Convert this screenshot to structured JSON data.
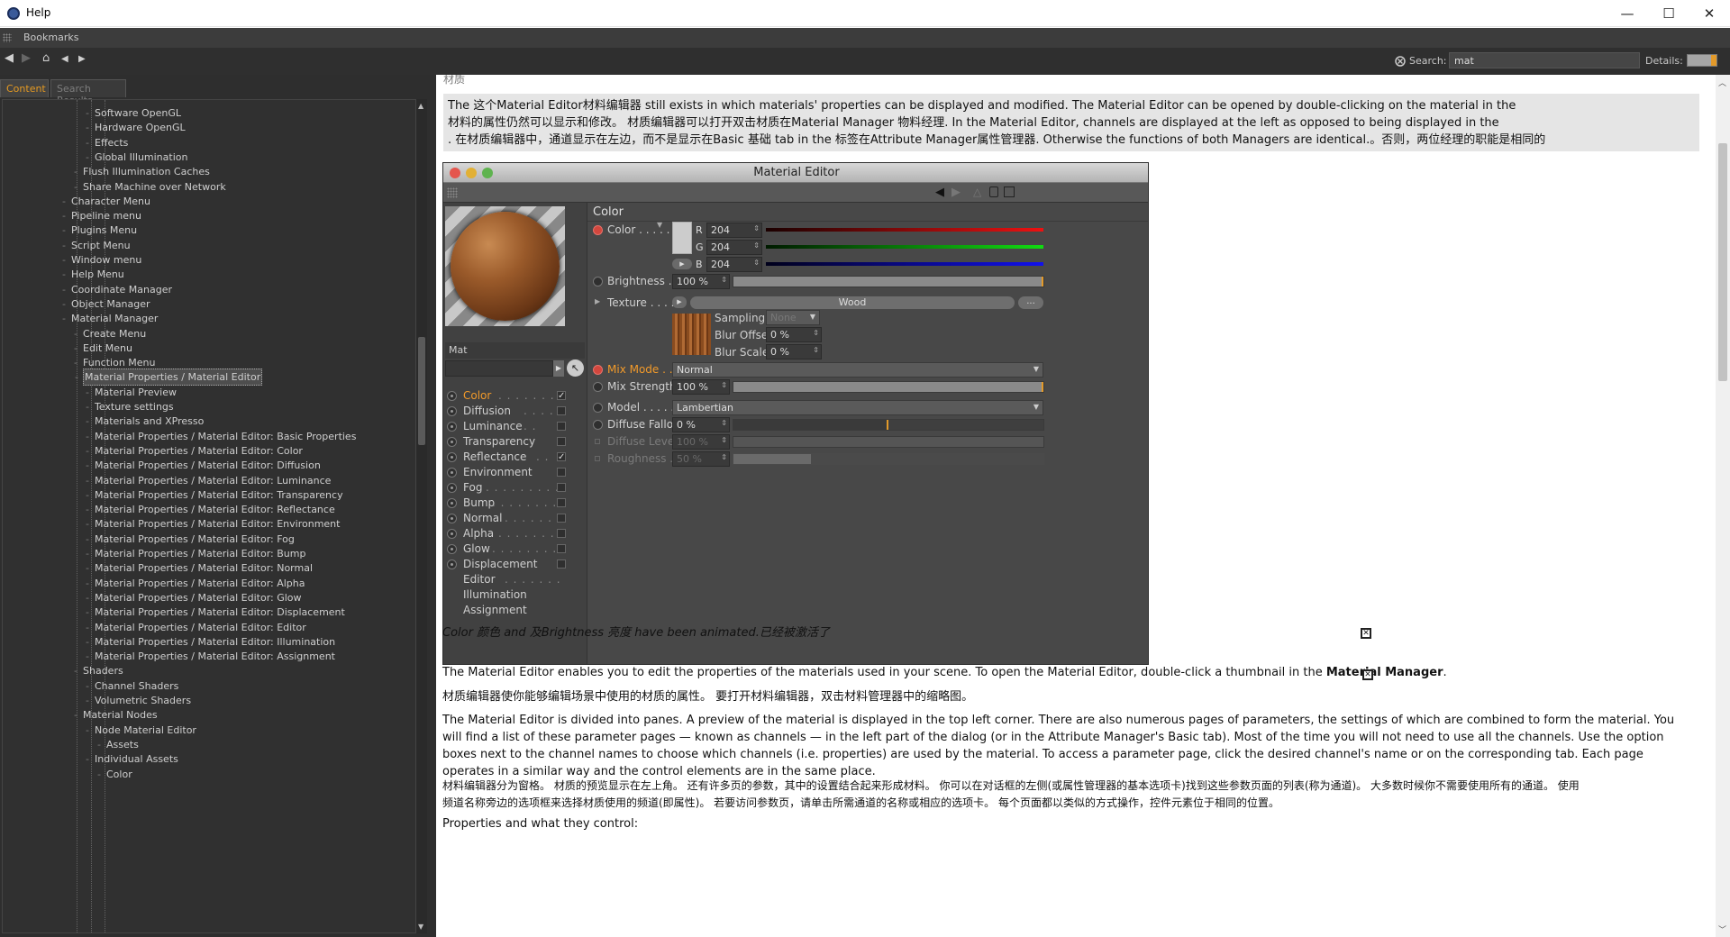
{
  "window": {
    "title": "Help",
    "minimize": "—",
    "maximize": "☐",
    "close": "✕"
  },
  "bookmarks": {
    "label": "Bookmarks"
  },
  "nav": {
    "back": "◀",
    "forward": "▶",
    "home": "⌂",
    "prev": "◀",
    "next": "▶"
  },
  "search": {
    "label": "Search:",
    "value": "mat"
  },
  "details": {
    "label": "Details:"
  },
  "tabs": {
    "content": "Content",
    "search_results": "Search Results"
  },
  "tree": [
    {
      "label": "Software OpenGL",
      "level": 2
    },
    {
      "label": "Hardware OpenGL",
      "level": 2
    },
    {
      "label": "Effects",
      "level": 2
    },
    {
      "label": "Global Illumination",
      "level": 2
    },
    {
      "label": "Flush Illumination Caches",
      "level": 1
    },
    {
      "label": "Share Machine over Network",
      "level": 1
    },
    {
      "label": "Character Menu",
      "level": 0
    },
    {
      "label": "Pipeline menu",
      "level": 0
    },
    {
      "label": "Plugins Menu",
      "level": 0
    },
    {
      "label": "Script Menu",
      "level": 0
    },
    {
      "label": "Window menu",
      "level": 0
    },
    {
      "label": "Help Menu",
      "level": 0
    },
    {
      "label": "Coordinate Manager",
      "level": 0
    },
    {
      "label": "Object Manager",
      "level": 0
    },
    {
      "label": "Material Manager",
      "level": 0
    },
    {
      "label": "Create Menu",
      "level": 1
    },
    {
      "label": "Edit Menu",
      "level": 1
    },
    {
      "label": "Function Menu",
      "level": 1
    },
    {
      "label": "Material Properties / Material Editor",
      "level": 1,
      "selected": true
    },
    {
      "label": "Material Preview",
      "level": 2
    },
    {
      "label": "Texture settings",
      "level": 2
    },
    {
      "label": "Materials and XPresso",
      "level": 2
    },
    {
      "label": "Material Properties / Material Editor: Basic Properties",
      "level": 2
    },
    {
      "label": "Material Properties / Material Editor: Color",
      "level": 2
    },
    {
      "label": "Material Properties / Material Editor: Diffusion",
      "level": 2
    },
    {
      "label": "Material Properties / Material Editor: Luminance",
      "level": 2
    },
    {
      "label": "Material Properties / Material Editor: Transparency",
      "level": 2
    },
    {
      "label": "Material Properties / Material Editor: Reflectance",
      "level": 2
    },
    {
      "label": "Material Properties / Material Editor: Environment",
      "level": 2
    },
    {
      "label": "Material Properties / Material Editor: Fog",
      "level": 2
    },
    {
      "label": "Material Properties / Material Editor: Bump",
      "level": 2
    },
    {
      "label": "Material Properties / Material Editor: Normal",
      "level": 2
    },
    {
      "label": "Material Properties / Material Editor: Alpha",
      "level": 2
    },
    {
      "label": "Material Properties / Material Editor: Glow",
      "level": 2
    },
    {
      "label": "Material Properties / Material Editor: Displacement",
      "level": 2
    },
    {
      "label": "Material Properties / Material Editor: Editor",
      "level": 2
    },
    {
      "label": "Material Properties / Material Editor: Illumination",
      "level": 2
    },
    {
      "label": "Material Properties / Material Editor: Assignment",
      "level": 2
    },
    {
      "label": "Shaders",
      "level": 1
    },
    {
      "label": "Channel Shaders",
      "level": 2
    },
    {
      "label": "Volumetric Shaders",
      "level": 2
    },
    {
      "label": "Material Nodes",
      "level": 1
    },
    {
      "label": "Node Material Editor",
      "level": 2
    },
    {
      "label": "Assets",
      "level": 3
    },
    {
      "label": "Individual Assets",
      "level": 2
    },
    {
      "label": "Color",
      "level": 3
    }
  ],
  "article": {
    "cutoff": "材质",
    "note_lines": [
      "The 这个Material Editor材料编辑器 still exists in which materials' properties can be displayed and modified. The Material Editor can be opened by double-clicking on the material in the",
      "材料的属性仍然可以显示和修改。 材质编辑器可以打开双击材质在Material Manager 物料经理. In the Material Editor, channels are displayed at the left as opposed to being displayed in the",
      ". 在材质编辑器中，通道显示在左边，而不是显示在Basic 基础 tab in the 标签在Attribute Manager属性管理器. Otherwise the functions of both Managers are identical.。否则，两位经理的职能是相同的"
    ],
    "caption": "Color 颜色 and 及Brightness 亮度 have been animated.已经被激活了",
    "p1_pre": "The Material Editor enables you to edit the properties of the materials used in your scene. To open the Material Editor, double-click a thumbnail in the ",
    "p1_bold": "Material Manager",
    "p1_post": ".",
    "p2": "材质编辑器使你能够编辑场景中使用的材质的属性。 要打开材料编辑器，双击材料管理器中的缩略图。",
    "p3_lines": [
      "The Material Editor is divided into panes. A preview of the material is displayed in the top left corner. There are also numerous pages of parameters, the settings of which are combined to form the material. You",
      "will find a list of these parameter pages — known as channels — in the left part of the dialog (or in the Attribute Manager's Basic tab). Most of the time you will not need to use all the channels. Use the option",
      "boxes next to the channel names to choose which channels (i.e. properties) are used by the material. To access a parameter page, click the desired channel's name or on the corresponding tab. Each page",
      "operates in a similar way and the control elements are in the same place."
    ],
    "p4_lines": [
      "材料编辑器分为窗格。 材质的预览显示在左上角。 还有许多页的参数，其中的设置结合起来形成材料。 你可以在对话框的左侧(或属性管理器的基本选项卡)找到这些参数页面的列表(称为通道)。 大多数时候你不需要使用所有的通道。 使用",
      "频道名称旁边的选项框来选择材质使用的频道(即属性)。 若要访问参数页，请单击所需通道的名称或相应的选项卡。 每个页面都以类似的方式操作，控件元素位于相同的位置。"
    ],
    "p5": "Properties and what they control:"
  },
  "me": {
    "title": "Material Editor",
    "mat_name": "Mat",
    "channels": [
      {
        "label": "Color",
        "dots": ". . . . . . .",
        "checked": true,
        "hl": true,
        "rb": true
      },
      {
        "label": "Diffusion",
        "dots": ". . . .",
        "checked": false,
        "rb": true
      },
      {
        "label": "Luminance",
        "dots": ". .",
        "checked": false,
        "rb": true
      },
      {
        "label": "Transparency",
        "dots": "",
        "checked": false,
        "rb": true
      },
      {
        "label": "Reflectance",
        "dots": ". .",
        "checked": true,
        "rb": true
      },
      {
        "label": "Environment",
        "dots": "",
        "checked": false,
        "rb": true
      },
      {
        "label": "Fog",
        "dots": ". . . . . . . . .",
        "checked": false,
        "rb": true
      },
      {
        "label": "Bump",
        "dots": ". . . . . . . .",
        "checked": false,
        "rb": true
      },
      {
        "label": "Normal",
        "dots": ". . . . . .",
        "checked": false,
        "rb": true
      },
      {
        "label": "Alpha",
        "dots": ". . . . . . .",
        "checked": false,
        "rb": true
      },
      {
        "label": "Glow",
        "dots": ". . . . . . . .",
        "checked": false,
        "rb": true
      },
      {
        "label": "Displacement",
        "dots": "",
        "checked": false,
        "rb": true
      },
      {
        "label": "Editor",
        "dots": ". . . . . . .",
        "cb": false,
        "rb": false
      },
      {
        "label": "Illumination",
        "dots": "",
        "cb": false,
        "rb": false
      },
      {
        "label": "Assignment",
        "dots": "",
        "cb": false,
        "rb": false
      }
    ],
    "section": "Color",
    "color_label": "Color . . . . .",
    "r_label": "R",
    "r": "204",
    "g_label": "G",
    "g": "204",
    "b_label": "B",
    "b": "204",
    "brightness_label": "Brightness . . .",
    "brightness": "100 %",
    "texture_label": "Texture . . . . .",
    "texture_name": "Wood",
    "texture_more": "...",
    "sampling_label": "Sampling",
    "sampling": "None",
    "bluroffset_label": "Blur Offset",
    "bluroffset": "0 %",
    "blurscale_label": "Blur Scale",
    "blurscale": "0 %",
    "mixmode_label": "Mix Mode . . .",
    "mixmode": "Normal",
    "mixstrength_label": "Mix Strength",
    "mixstrength": "100 %",
    "model_label": "Model . . . . . . .",
    "model": "Lambertian",
    "difffalloff_label": "Diffuse Falloff",
    "difffalloff": "0 %",
    "difflevel_label": "Diffuse Level",
    "difflevel": "100 %",
    "roughness_label": "Roughness . . .",
    "roughness": "50 %",
    "brightness_fill": 1.0,
    "mixstrength_fill": 1.0,
    "falloff_fill": 0.5,
    "roughness_fill": 0.25
  },
  "colors": {
    "accent": "#e59a22",
    "red": "#d2473e",
    "green_ring": "#2a9a6c"
  }
}
